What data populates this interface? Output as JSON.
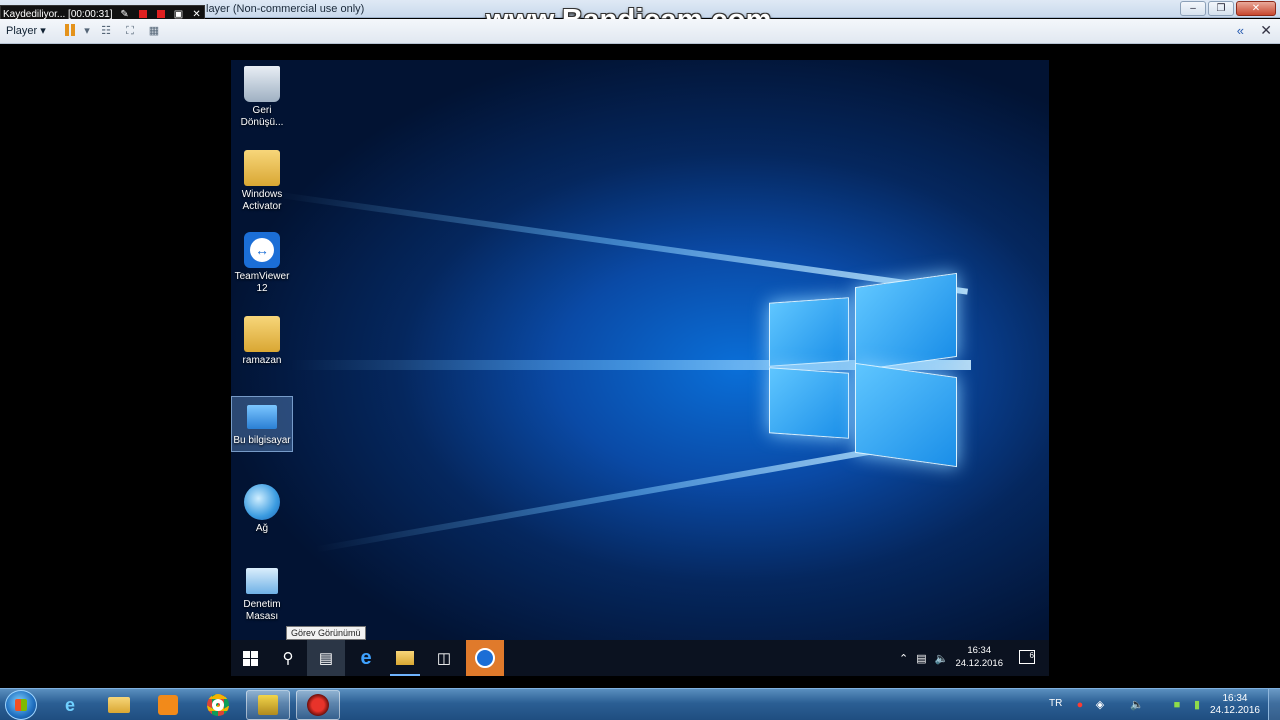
{
  "host_window": {
    "title_fragment": "layer (Non-commercial use only)",
    "controls": [
      "minimize",
      "maximize",
      "close"
    ]
  },
  "recorder": {
    "status": "Kaydediliyor... [00:00:31]",
    "watermark": "www.Bandicam.com",
    "icons": [
      "pencil-icon",
      "record-icon",
      "stop-icon",
      "camera-icon",
      "close-icon"
    ]
  },
  "toolbar": {
    "player_menu": "Player ▾",
    "icons": [
      "pause-icon",
      "dropdown-icon",
      "send-keys-icon",
      "fullscreen-icon",
      "unity-icon"
    ],
    "right_icons": [
      "collapse-icon",
      "close-icon"
    ]
  },
  "desktop_icons": [
    {
      "name": "recycle-bin",
      "label": "Geri Dönüşü...",
      "icon": "recycle-bin-icon"
    },
    {
      "name": "windows-activator",
      "label": "Windows Activator",
      "icon": "folder-icon"
    },
    {
      "name": "teamviewer",
      "label": "TeamViewer 12",
      "icon": "teamviewer-icon"
    },
    {
      "name": "ramazan",
      "label": "ramazan",
      "icon": "user-folder-icon"
    },
    {
      "name": "this-pc",
      "label": "Bu bilgisayar",
      "icon": "computer-icon",
      "selected": true
    },
    {
      "name": "network",
      "label": "Ağ",
      "icon": "network-icon"
    },
    {
      "name": "control-panel",
      "label": "Denetim Masası",
      "icon": "control-panel-icon"
    }
  ],
  "guest_taskbar": {
    "tooltip": "Görev Görünümü",
    "buttons": [
      "start-icon",
      "search-icon",
      "task-view-icon",
      "edge-icon",
      "file-explorer-icon",
      "store-icon",
      "teamviewer-icon"
    ],
    "tray_icons": [
      "chevron-up-icon",
      "network-icon",
      "volume-icon"
    ],
    "time": "16:34",
    "date": "24.12.2016",
    "notification_count": "6"
  },
  "host_taskbar": {
    "buttons": [
      "ie-icon",
      "explorer-icon",
      "media-player-icon",
      "chrome-icon",
      "winrar-icon",
      "bandicam-icon"
    ],
    "language": "TR",
    "time": "16:34",
    "date": "24.12.2016"
  },
  "colors": {
    "wallpaper_accent": "#0a6fd8",
    "teamviewer_orange": "#e07a2b",
    "rec_red": "#e02020"
  }
}
